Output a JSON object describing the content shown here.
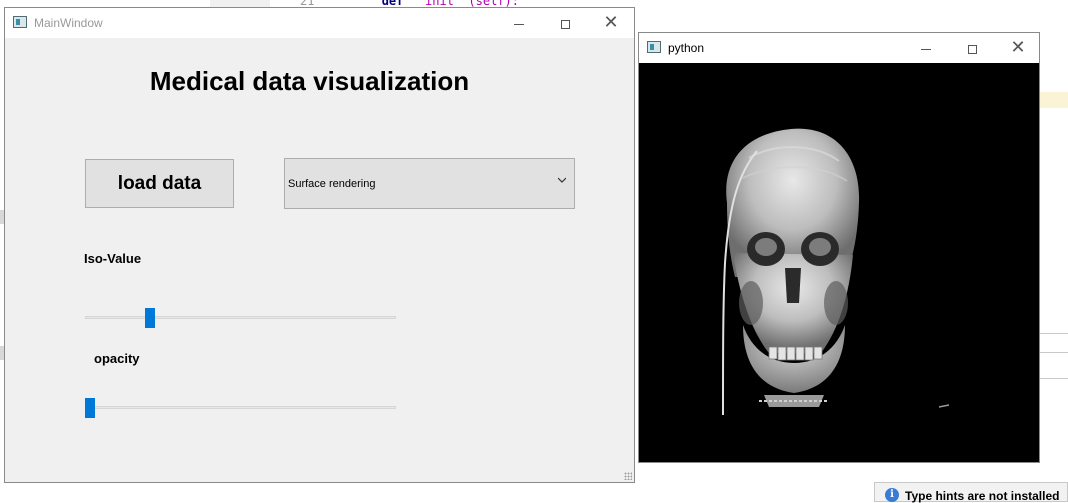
{
  "main_window": {
    "title": "MainWindow",
    "heading": "Medical data visualization",
    "load_button_label": "load data",
    "render_mode": {
      "selected": "Surface rendering"
    },
    "iso_label": "Iso-Value",
    "iso_slider_level": 0.2,
    "opacity_label": "opacity",
    "opacity_slider_level": 0.0
  },
  "python_window": {
    "title": "python"
  },
  "background_editor": {
    "code_line_number": "21",
    "code_keyword": "def",
    "code_text": "__init__(self):"
  },
  "notification": {
    "text": "Type hints are not installed"
  },
  "colors": {
    "slider_accent": "#0078d7",
    "window_bg": "#f0f0f0",
    "render_bg": "#000000"
  }
}
